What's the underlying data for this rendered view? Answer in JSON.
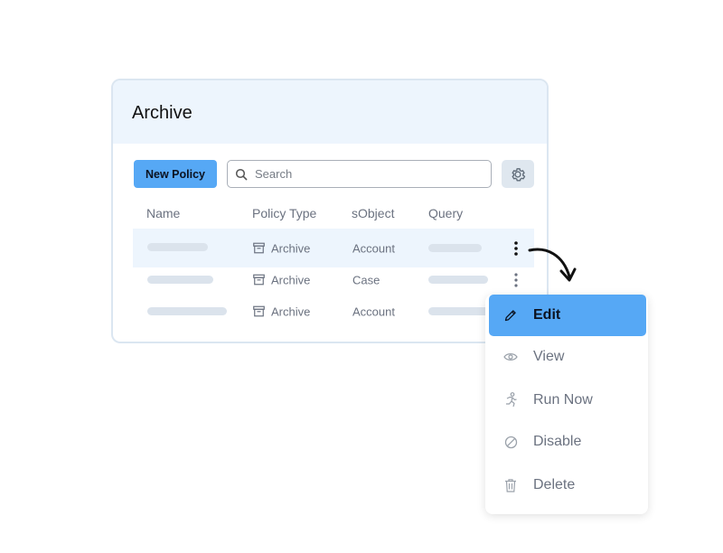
{
  "card": {
    "title": "Archive"
  },
  "toolbar": {
    "new_policy_label": "New Policy",
    "search_placeholder": "Search"
  },
  "table": {
    "columns": [
      "Name",
      "Policy Type",
      "sObject",
      "Query"
    ],
    "rows": [
      {
        "policy_type": "Archive",
        "sobject": "Account",
        "active": true
      },
      {
        "policy_type": "Archive",
        "sobject": "Case",
        "active": false
      },
      {
        "policy_type": "Archive",
        "sobject": "Account",
        "active": false
      }
    ]
  },
  "menu": {
    "items": [
      {
        "label": "Edit",
        "icon": "pencil-icon",
        "active": true
      },
      {
        "label": "View",
        "icon": "eye-icon",
        "active": false
      },
      {
        "label": "Run Now",
        "icon": "running-person-icon",
        "active": false
      },
      {
        "label": "Disable",
        "icon": "disable-icon",
        "active": false
      },
      {
        "label": "Delete",
        "icon": "trash-icon",
        "active": false
      }
    ]
  },
  "colors": {
    "accent": "#56a8f5",
    "header_bg": "#edf5fd",
    "skeleton": "#dbe3ec"
  }
}
